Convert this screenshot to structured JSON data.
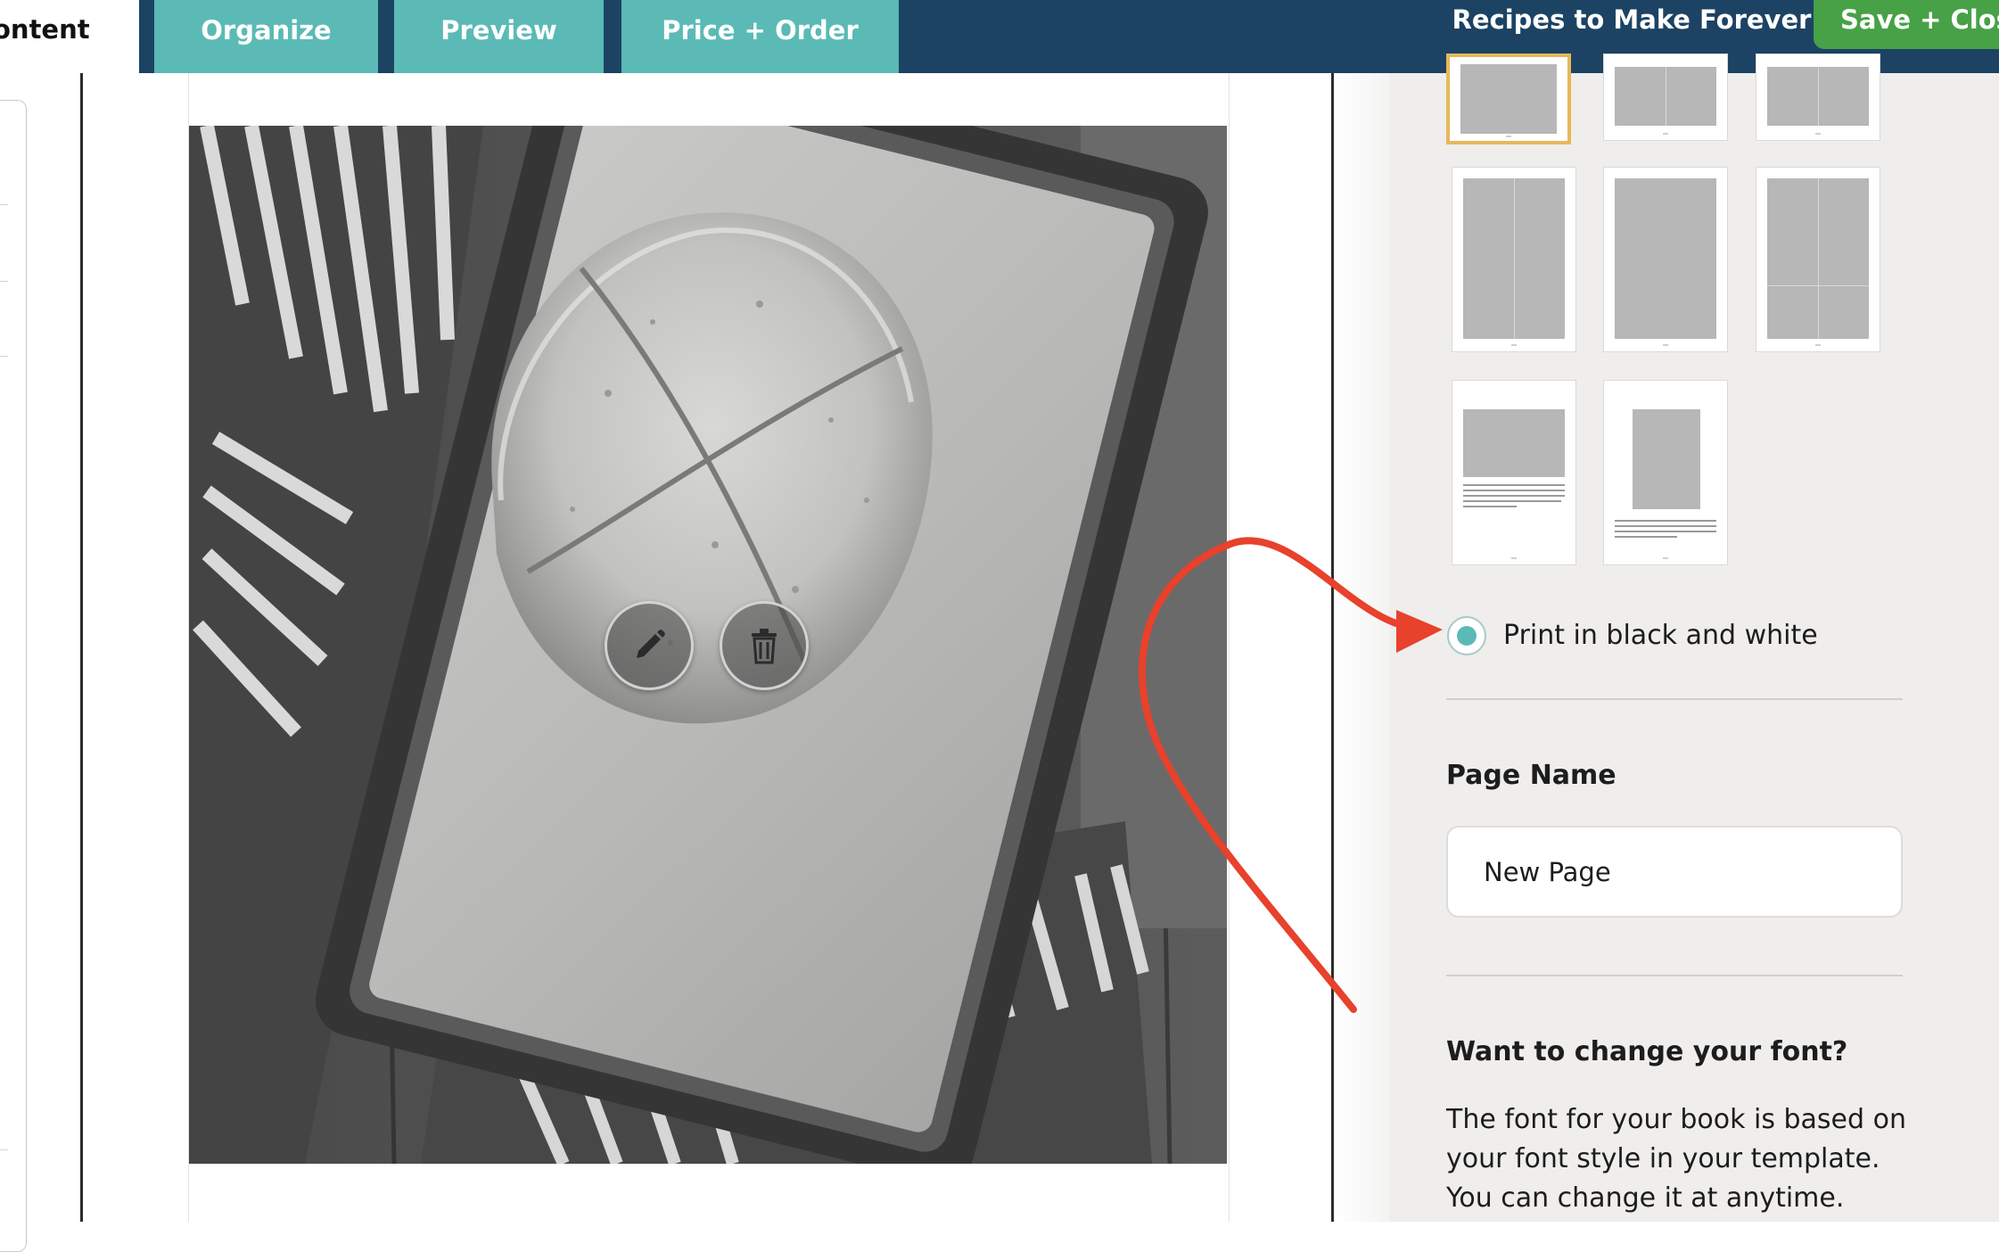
{
  "header": {
    "tabs": [
      {
        "label": "ontent",
        "active": true
      },
      {
        "label": "Organize"
      },
      {
        "label": "Preview"
      },
      {
        "label": "Price + Order"
      }
    ],
    "book_title": "Recipes to Make Forever",
    "save_label": "Save + Close"
  },
  "canvas": {
    "photo_subject": "Round loaf of soda bread with a cross scored on top, on a baking sheet lined with parchment, striped kitchen towel underneath, black and white",
    "image_actions": [
      "edit-icon",
      "trash-icon"
    ]
  },
  "layout_panel": {
    "layout_thumbnails": [
      "layout-1",
      "layout-2",
      "layout-3",
      "layout-4",
      "layout-5",
      "layout-6",
      "layout-7",
      "layout-8"
    ],
    "selected_layout": "layout-1",
    "bw_option": {
      "label": "Print in black and white",
      "selected": true
    },
    "page_name": {
      "label": "Page Name",
      "value": "New Page"
    },
    "font_section": {
      "heading": "Want to change your font?",
      "text": "The font for your book is based on your font style in your template. You can change it at anytime."
    }
  },
  "colors": {
    "header_bg": "#1c4364",
    "tab_teal": "#5bbab5",
    "save_green": "#47a146",
    "panel_bg": "#efeeec",
    "selected_border": "#e6b85a",
    "arrow_red": "#e8412c"
  }
}
